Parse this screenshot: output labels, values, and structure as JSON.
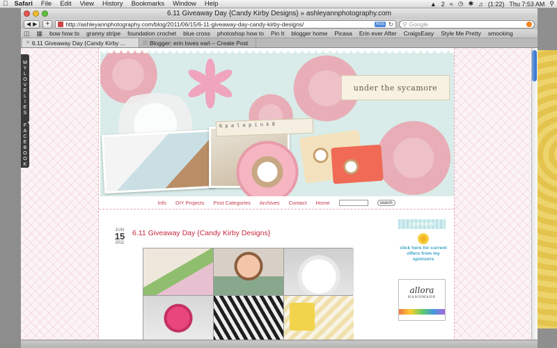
{
  "menubar": {
    "app": "Safari",
    "items": [
      "File",
      "Edit",
      "View",
      "History",
      "Bookmarks",
      "Window",
      "Help"
    ],
    "battery": "(1:22)",
    "clock": "Thu 7:53 AM",
    "badge": "2"
  },
  "window": {
    "title": "6.11 Giveaway Day {Candy Kirby Designs} » ashleyannphotography.com"
  },
  "toolbar": {
    "url": "http://ashleyannphotography.com/blog/2011/06/15/6-11-giveaway-day-candy-kirby-designs/",
    "rss": "RSS",
    "search_placeholder": "Google"
  },
  "bookmarks": [
    "bow how to",
    "granny stripe",
    "foundation crochet",
    "blue cross",
    "photoshop how to",
    "Pin It",
    "blogger home",
    "Picasa",
    "Erin ever After",
    "CraigsEasy",
    "Style Me Pretty",
    "smocking"
  ],
  "tabs": [
    {
      "label": "6.11 Giveaway Day {Candy Kirby ..."
    },
    {
      "label": "Blogger: erin loves earl – Create Post"
    }
  ],
  "sidetabs": {
    "tab1": [
      "M",
      "Y",
      "",
      "L",
      "O",
      "V",
      "E",
      "L",
      "I",
      "E",
      "S"
    ],
    "tab2": [
      "F",
      "A",
      "C",
      "E",
      "B",
      "O",
      "O",
      "K"
    ]
  },
  "header": {
    "blog_name": "under the sycamore",
    "stamp_text": "6  p a l e  p i n k  8"
  },
  "nav": {
    "items": [
      "Info",
      "DIY Projects",
      "Post Categories",
      "Archives",
      "Contact",
      "Home"
    ],
    "search_button": "search"
  },
  "post": {
    "month": "JUN",
    "day": "15",
    "year": "2011",
    "title": "6.11 Giveaway Day {Candy Kirby Designs}"
  },
  "sidebar": {
    "sponsors_title": "sponsors",
    "sponsor_text": "click here for current offers from my sponsors",
    "ad_name": "allora",
    "ad_sub": "HANDMADE"
  },
  "colors": {
    "accent": "#c6283d",
    "sponsor_link": "#3ba3c6"
  }
}
